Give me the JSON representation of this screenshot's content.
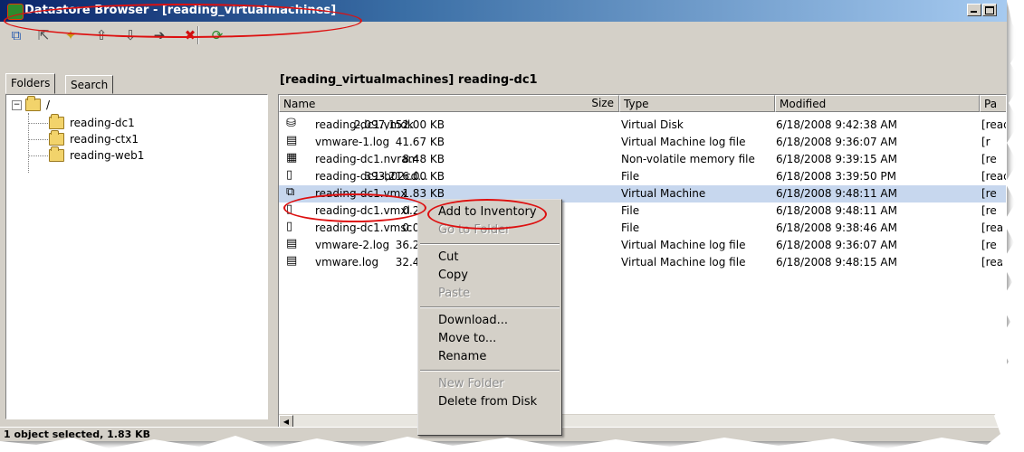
{
  "window": {
    "title": "Datastore Browser - [reading_virtualmachines]",
    "status": "1 object selected, 1.83 KB"
  },
  "toolbar": {
    "buttons": [
      {
        "name": "browse-datastore-icon",
        "glyph": "⧉"
      },
      {
        "name": "parent-folder-icon",
        "glyph": "⇱"
      },
      {
        "name": "new-folder-icon",
        "glyph": "✦"
      },
      {
        "name": "upload-icon",
        "glyph": "⇧"
      },
      {
        "name": "download-icon",
        "glyph": "⇩"
      },
      {
        "name": "move-to-icon",
        "glyph": "➔"
      },
      {
        "name": "delete-icon",
        "glyph": "✖"
      },
      {
        "name": "refresh-icon",
        "glyph": "⟳"
      }
    ]
  },
  "left_panel": {
    "tabs": [
      "Folders",
      "Search"
    ],
    "tree": {
      "root": "/",
      "children": [
        "reading-dc1",
        "reading-ctx1",
        "reading-web1"
      ]
    }
  },
  "right_panel": {
    "path": "[reading_virtualmachines] reading-dc1",
    "columns": [
      "Name",
      "Size",
      "Type",
      "Modified",
      "Pa"
    ],
    "rows": [
      {
        "icon": "virtual-disk-icon",
        "glyph": "⛁",
        "name": "reading-dc1.vmdk",
        "size": "2,097,152.00 KB",
        "type": "Virtual Disk",
        "modified": "6/18/2008 9:42:38 AM",
        "path": "[read"
      },
      {
        "icon": "log-file-icon",
        "glyph": "▤",
        "name": "vmware-1.log",
        "size": "41.67 KB",
        "type": "Virtual Machine log file",
        "modified": "6/18/2008 9:36:07 AM",
        "path": "[r"
      },
      {
        "icon": "nvram-icon",
        "glyph": "▦",
        "name": "reading-dc1.nvram",
        "size": "8.48 KB",
        "type": "Non-volatile memory file",
        "modified": "6/18/2008 9:39:15 AM",
        "path": "[re"
      },
      {
        "icon": "file-icon",
        "glyph": "▯",
        "name": "reading-dc1-b02cd...",
        "size": "393,216.00 KB",
        "type": "File",
        "modified": "6/18/2008 3:39:50 PM",
        "path": "[read"
      },
      {
        "icon": "virtual-machine-icon",
        "glyph": "⧉",
        "name": "reading-dc1.vmx",
        "size": "1.83 KB",
        "type": "Virtual Machine",
        "modified": "6/18/2008 9:48:11 AM",
        "path": "[re"
      },
      {
        "icon": "file-icon",
        "glyph": "▯",
        "name": "reading-dc1.vmxl",
        "size": "0.26 KB",
        "type": "File",
        "modified": "6/18/2008 9:48:11 AM",
        "path": "[re"
      },
      {
        "icon": "file-icon",
        "glyph": "▯",
        "name": "reading-dc1.vmsc",
        "size": "0.00 KB",
        "type": "File",
        "modified": "6/18/2008 9:38:46 AM",
        "path": "[rea"
      },
      {
        "icon": "log-file-icon",
        "glyph": "▤",
        "name": "vmware-2.log",
        "size": "36.25 KB",
        "type": "Virtual Machine log file",
        "modified": "6/18/2008 9:36:07 AM",
        "path": "[re"
      },
      {
        "icon": "log-file-icon",
        "glyph": "▤",
        "name": "vmware.log",
        "size": "32.45 KB",
        "type": "Virtual Machine log file",
        "modified": "6/18/2008 9:48:15 AM",
        "path": "[read"
      }
    ],
    "selected_index": 4
  },
  "context_menu": {
    "items": [
      {
        "label": "Add to Inventory",
        "enabled": true
      },
      {
        "label": "Go to Folder",
        "enabled": false
      },
      {
        "sep": true
      },
      {
        "label": "Cut",
        "enabled": true
      },
      {
        "label": "Copy",
        "enabled": true
      },
      {
        "label": "Paste",
        "enabled": false
      },
      {
        "sep": true
      },
      {
        "label": "Download...",
        "enabled": true
      },
      {
        "label": "Move to...",
        "enabled": true
      },
      {
        "label": "Rename",
        "enabled": true
      },
      {
        "sep": true
      },
      {
        "label": "New Folder",
        "enabled": false
      },
      {
        "label": "Delete from Disk",
        "enabled": true
      }
    ]
  },
  "colors": {
    "annotation": "#dd1010",
    "selection": "#c7d7ee",
    "titlebar": "#0a246a"
  }
}
